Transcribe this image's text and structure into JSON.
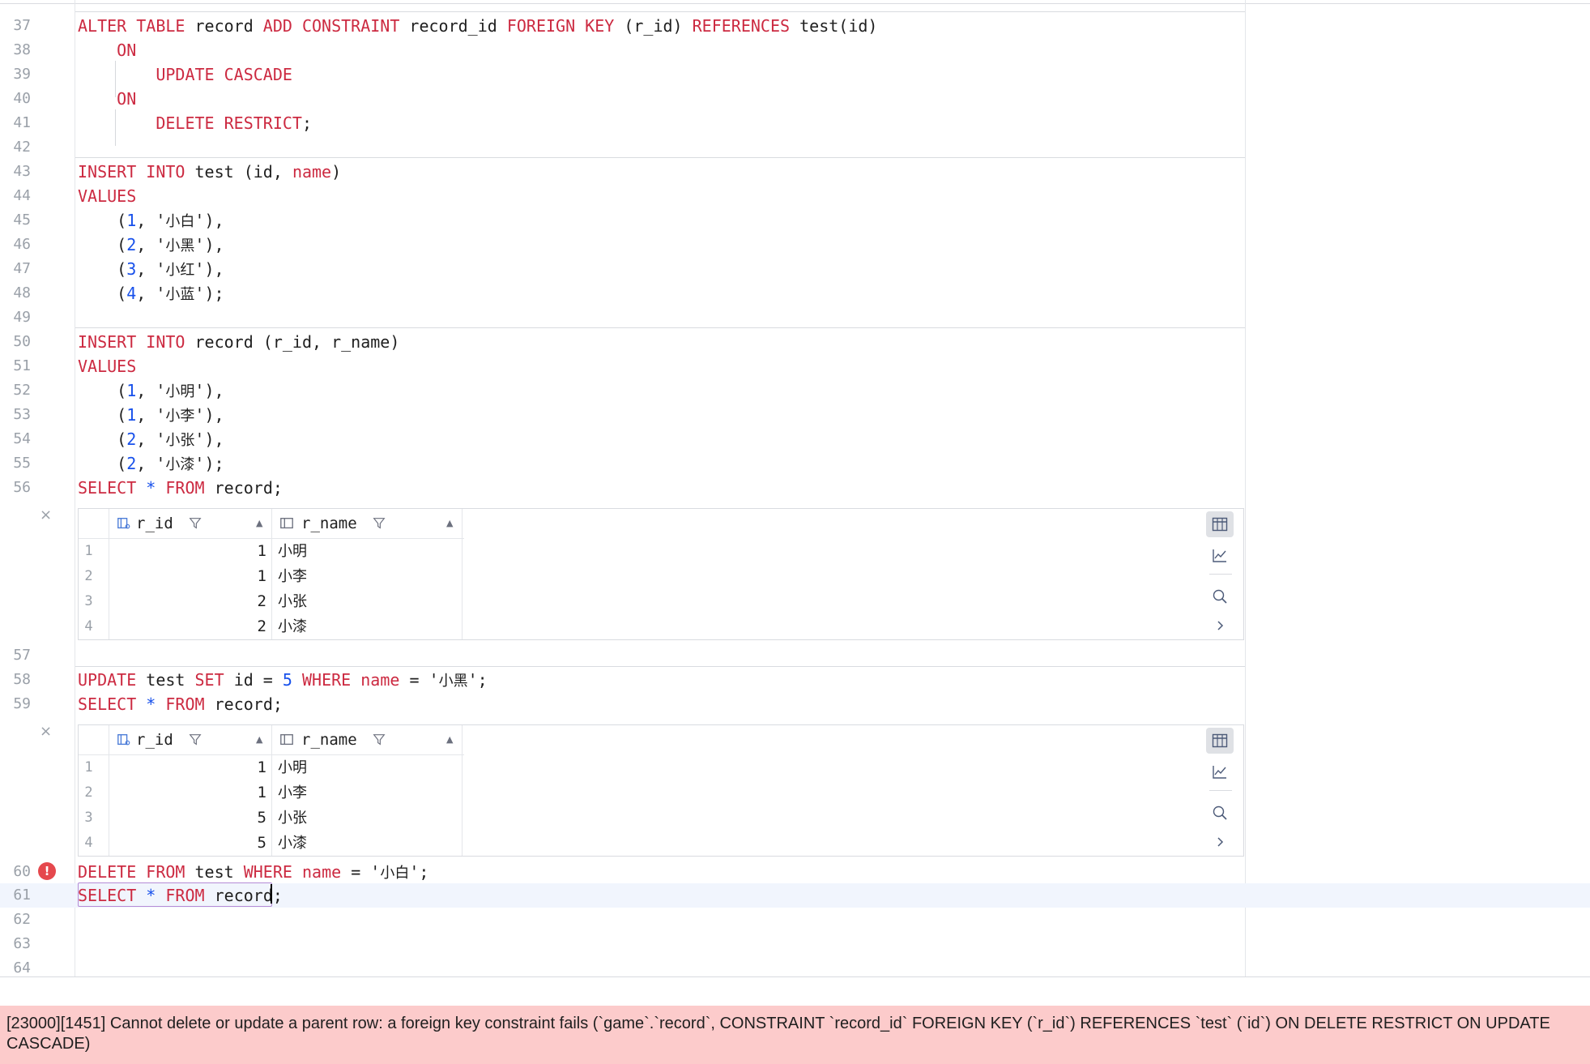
{
  "editor": {
    "lines": [
      {
        "n": "37"
      },
      {
        "n": "38"
      },
      {
        "n": "39"
      },
      {
        "n": "40"
      },
      {
        "n": "41"
      },
      {
        "n": "42"
      },
      {
        "n": "43"
      },
      {
        "n": "44"
      },
      {
        "n": "45"
      },
      {
        "n": "46"
      },
      {
        "n": "47"
      },
      {
        "n": "48"
      },
      {
        "n": "49"
      },
      {
        "n": "50"
      },
      {
        "n": "51"
      },
      {
        "n": "52"
      },
      {
        "n": "53"
      },
      {
        "n": "54"
      },
      {
        "n": "55"
      },
      {
        "n": "56"
      },
      {
        "n": "57"
      },
      {
        "n": "58"
      },
      {
        "n": "59"
      },
      {
        "n": "60"
      },
      {
        "n": "61"
      },
      {
        "n": "62"
      },
      {
        "n": "63"
      },
      {
        "n": "64"
      }
    ],
    "tokens": {
      "alter": "ALTER TABLE",
      "record": "record",
      "add_constraint": "ADD CONSTRAINT",
      "record_id": "record_id",
      "foreign_key": "FOREIGN KEY",
      "r_id_paren": "(r_id)",
      "references": "REFERENCES",
      "test_id": "test(id)",
      "on": "ON",
      "update_cascade": "UPDATE CASCADE",
      "delete_restrict": "DELETE RESTRICT",
      "semicolon": ";",
      "insert_into": "INSERT INTO",
      "test": "test",
      "id_open": "(id,",
      "name": "name",
      "close": ")",
      "values": "VALUES",
      "record_cols": "(r_id, r_name)",
      "select": "SELECT",
      "star": "*",
      "from": "FROM",
      "record_semi": "record;",
      "update": "UPDATE",
      "set": "SET",
      "id_eq": "id =",
      "five": "5",
      "where": "WHERE",
      "eq": "=",
      "delete_from": "DELETE FROM",
      "record_cursor": "record"
    },
    "inserts_test": [
      {
        "num": "1",
        "val": "小白",
        "end": "),"
      },
      {
        "num": "2",
        "val": "小黑",
        "end": "),"
      },
      {
        "num": "3",
        "val": "小红",
        "end": "),"
      },
      {
        "num": "4",
        "val": "小蓝",
        "end": ");"
      }
    ],
    "inserts_record": [
      {
        "num": "1",
        "val": "小明",
        "end": "),"
      },
      {
        "num": "1",
        "val": "小李",
        "end": "),"
      },
      {
        "num": "2",
        "val": "小张",
        "end": "),"
      },
      {
        "num": "2",
        "val": "小漆",
        "end": ");"
      }
    ],
    "update_name": "小黑",
    "delete_name": "小白"
  },
  "results": [
    {
      "columns": [
        "r_id",
        "r_name"
      ],
      "rows": [
        {
          "n": "1",
          "r_id": "1",
          "r_name": "小明"
        },
        {
          "n": "2",
          "r_id": "1",
          "r_name": "小李"
        },
        {
          "n": "3",
          "r_id": "2",
          "r_name": "小张"
        },
        {
          "n": "4",
          "r_id": "2",
          "r_name": "小漆"
        }
      ]
    },
    {
      "columns": [
        "r_id",
        "r_name"
      ],
      "rows": [
        {
          "n": "1",
          "r_id": "1",
          "r_name": "小明"
        },
        {
          "n": "2",
          "r_id": "1",
          "r_name": "小李"
        },
        {
          "n": "3",
          "r_id": "5",
          "r_name": "小张"
        },
        {
          "n": "4",
          "r_id": "5",
          "r_name": "小漆"
        }
      ]
    }
  ],
  "icons": {
    "close": "×",
    "error": "!",
    "more": "›"
  },
  "colors": {
    "keyword": "#cc2a41",
    "number": "#1750eb",
    "error_bar": "#fccbcb",
    "error_icon": "#e5484d",
    "current_line": "#f1f5fd"
  },
  "error_message": "[23000][1451] Cannot delete or update a parent row: a foreign key constraint fails (`game`.`record`, CONSTRAINT `record_id` FOREIGN KEY (`r_id`) REFERENCES `test` (`id`) ON DELETE RESTRICT ON UPDATE CASCADE)"
}
